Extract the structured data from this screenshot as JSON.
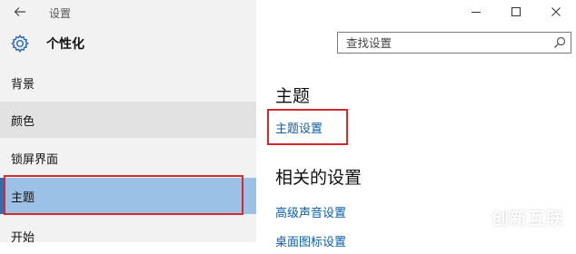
{
  "window": {
    "title": "设置",
    "back_icon": "back-arrow-icon",
    "controls": [
      "minimize-icon",
      "maximize-icon",
      "close-icon"
    ]
  },
  "header": {
    "icon": "gear-icon",
    "title": "个性化"
  },
  "search": {
    "placeholder": "查找设置",
    "icon": "search-icon"
  },
  "sidebar": {
    "items": [
      {
        "label": "背景",
        "state": "normal"
      },
      {
        "label": "颜色",
        "state": "hover"
      },
      {
        "label": "锁屏界面",
        "state": "normal"
      },
      {
        "label": "主题",
        "state": "selected"
      },
      {
        "label": "开始",
        "state": "normal"
      }
    ]
  },
  "main": {
    "section_title": "主题",
    "theme_settings_link": "主题设置",
    "related_title": "相关的设置",
    "related_links": [
      "高级声音设置",
      "桌面图标设置"
    ]
  },
  "watermark": {
    "text": "创新互联",
    "icon": "brand-logo-icon"
  },
  "colors": {
    "accent": "#0a5fa8",
    "selected_bg": "#9bc2e6",
    "selected_bar": "#2e6fb3",
    "annotation": "#d72a2a",
    "sidebar_bg": "#f2f2f2"
  }
}
